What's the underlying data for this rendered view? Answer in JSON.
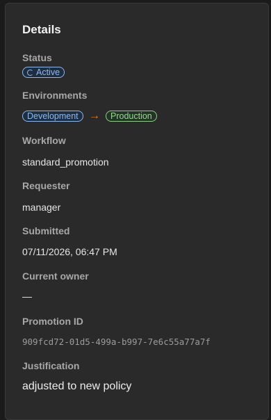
{
  "details": {
    "title": "Details",
    "status": {
      "label": "Status",
      "value": "Active"
    },
    "environments": {
      "label": "Environments",
      "from": "Development",
      "arrow": "→",
      "to": "Production"
    },
    "workflow": {
      "label": "Workflow",
      "value": "standard_promotion"
    },
    "requester": {
      "label": "Requester",
      "value": "manager"
    },
    "submitted": {
      "label": "Submitted",
      "value": "07/11/2026, 06:47 PM"
    },
    "current_owner": {
      "label": "Current owner",
      "value": "—"
    },
    "promotion_id": {
      "label": "Promotion ID",
      "value": "909fcd72-01d5-499a-b997-7e6c55a77a7f"
    },
    "justification": {
      "label": "Justification",
      "value": "adjusted to new policy"
    }
  },
  "colors": {
    "status_active": "#8fb9ea",
    "env_dev": "#8fb9ea",
    "env_prod": "#8fcf8a",
    "arrow": "#e67e22"
  },
  "icons": {
    "status": "spinner-icon",
    "transition": "arrow-right-icon"
  }
}
